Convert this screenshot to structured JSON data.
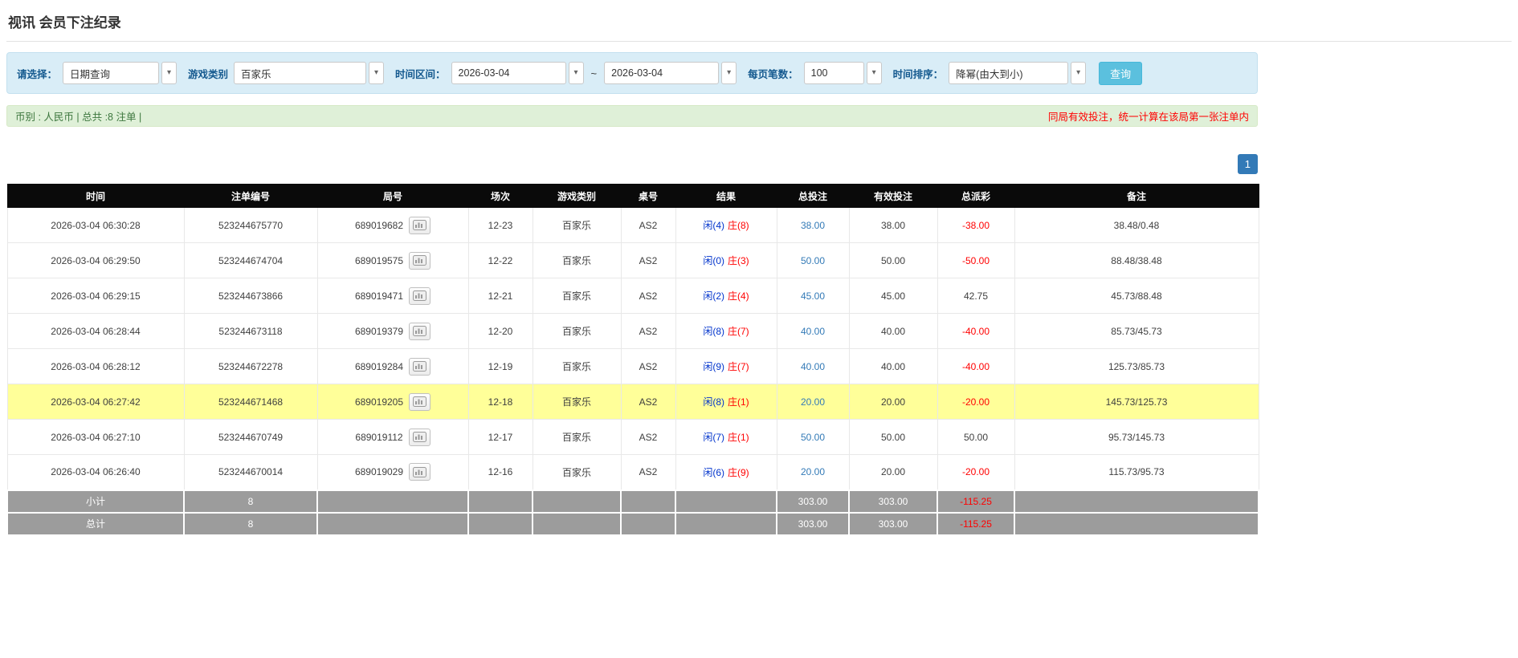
{
  "page": {
    "title": "视讯 会员下注纪录"
  },
  "icons": {
    "dropdown_arrow": "▾",
    "replay_icon": "video-replay"
  },
  "filters": {
    "select_label": "请选择：",
    "select_value": "日期查询",
    "game_label": "游戏类别",
    "game_value": "百家乐",
    "range_label": "时间区间：",
    "date_from": "2026-03-04",
    "date_separator": "~",
    "date_to": "2026-03-04",
    "page_size_label": "每页笔数：",
    "page_size_value": "100",
    "sort_label": "时间排序：",
    "sort_value": "降幂(由大到小)",
    "search_button": "查询"
  },
  "summary": {
    "left_text": "币别 : 人民币 | 总共 :8 注单 |",
    "right_notice": "同局有效投注，统一计算在该局第一张注单内"
  },
  "pagination": {
    "current_page": "1"
  },
  "table": {
    "headers": [
      "时间",
      "注单编号",
      "局号",
      "场次",
      "游戏类别",
      "桌号",
      "结果",
      "总投注",
      "有效投注",
      "总派彩",
      "备注"
    ],
    "rows": [
      {
        "time": "2026-03-04 06:30:28",
        "bet_id": "523244675770",
        "round_id": "689019682",
        "session": "12-23",
        "game_type": "百家乐",
        "table_no": "AS2",
        "result_player": "闲(4)",
        "result_banker": "庄(8)",
        "total_bet": "38.00",
        "valid_bet": "38.00",
        "payout": "-38.00",
        "remark": "38.48/0.48",
        "highlighted": false
      },
      {
        "time": "2026-03-04 06:29:50",
        "bet_id": "523244674704",
        "round_id": "689019575",
        "session": "12-22",
        "game_type": "百家乐",
        "table_no": "AS2",
        "result_player": "闲(0)",
        "result_banker": "庄(3)",
        "total_bet": "50.00",
        "valid_bet": "50.00",
        "payout": "-50.00",
        "remark": "88.48/38.48",
        "highlighted": false
      },
      {
        "time": "2026-03-04 06:29:15",
        "bet_id": "523244673866",
        "round_id": "689019471",
        "session": "12-21",
        "game_type": "百家乐",
        "table_no": "AS2",
        "result_player": "闲(2)",
        "result_banker": "庄(4)",
        "total_bet": "45.00",
        "valid_bet": "45.00",
        "payout": "42.75",
        "remark": "45.73/88.48",
        "highlighted": false
      },
      {
        "time": "2026-03-04 06:28:44",
        "bet_id": "523244673118",
        "round_id": "689019379",
        "session": "12-20",
        "game_type": "百家乐",
        "table_no": "AS2",
        "result_player": "闲(8)",
        "result_banker": "庄(7)",
        "total_bet": "40.00",
        "valid_bet": "40.00",
        "payout": "-40.00",
        "remark": "85.73/45.73",
        "highlighted": false
      },
      {
        "time": "2026-03-04 06:28:12",
        "bet_id": "523244672278",
        "round_id": "689019284",
        "session": "12-19",
        "game_type": "百家乐",
        "table_no": "AS2",
        "result_player": "闲(9)",
        "result_banker": "庄(7)",
        "total_bet": "40.00",
        "valid_bet": "40.00",
        "payout": "-40.00",
        "remark": "125.73/85.73",
        "highlighted": false
      },
      {
        "time": "2026-03-04 06:27:42",
        "bet_id": "523244671468",
        "round_id": "689019205",
        "session": "12-18",
        "game_type": "百家乐",
        "table_no": "AS2",
        "result_player": "闲(8)",
        "result_banker": "庄(1)",
        "total_bet": "20.00",
        "valid_bet": "20.00",
        "payout": "-20.00",
        "remark": "145.73/125.73",
        "highlighted": true
      },
      {
        "time": "2026-03-04 06:27:10",
        "bet_id": "523244670749",
        "round_id": "689019112",
        "session": "12-17",
        "game_type": "百家乐",
        "table_no": "AS2",
        "result_player": "闲(7)",
        "result_banker": "庄(1)",
        "total_bet": "50.00",
        "valid_bet": "50.00",
        "payout": "50.00",
        "remark": "95.73/145.73",
        "highlighted": false
      },
      {
        "time": "2026-03-04 06:26:40",
        "bet_id": "523244670014",
        "round_id": "689019029",
        "session": "12-16",
        "game_type": "百家乐",
        "table_no": "AS2",
        "result_player": "闲(6)",
        "result_banker": "庄(9)",
        "total_bet": "20.00",
        "valid_bet": "20.00",
        "payout": "-20.00",
        "remark": "115.73/95.73",
        "highlighted": false
      }
    ],
    "subtotal": {
      "label": "小计",
      "count": "8",
      "total_bet": "303.00",
      "valid_bet": "303.00",
      "payout": "-115.25"
    },
    "total": {
      "label": "总计",
      "count": "8",
      "total_bet": "303.00",
      "valid_bet": "303.00",
      "payout": "-115.25"
    }
  }
}
